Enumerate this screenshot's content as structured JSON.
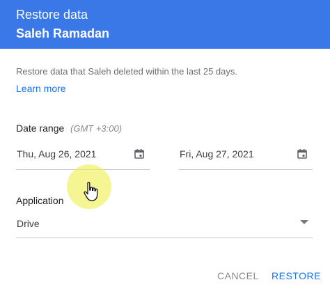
{
  "header": {
    "title": "Restore data",
    "user_name": "Saleh Ramadan"
  },
  "body": {
    "description": "Restore data that Saleh deleted within the last 25 days.",
    "learn_more": "Learn more"
  },
  "date_range": {
    "label": "Date range",
    "timezone": "(GMT +3:00)",
    "start": "Thu, Aug 26, 2021",
    "end": "Fri, Aug 27, 2021",
    "icon": "calendar-icon"
  },
  "application": {
    "label": "Application",
    "selected": "Drive"
  },
  "actions": {
    "cancel": "CANCEL",
    "restore": "RESTORE"
  },
  "colors": {
    "header_bg": "#3b78e7",
    "accent": "#1a73e8",
    "cursor_highlight": "#f0f05a"
  }
}
